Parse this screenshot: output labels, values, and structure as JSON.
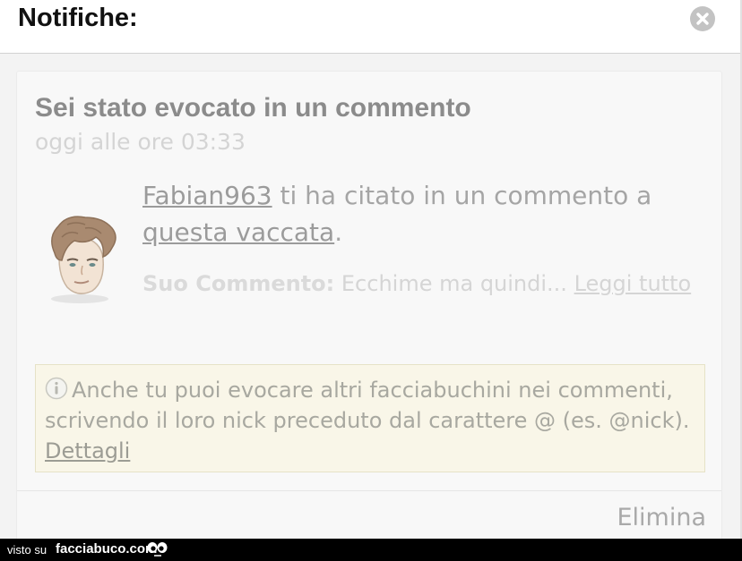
{
  "header": {
    "title": "Notifiche:",
    "close_icon": "close-circle-icon"
  },
  "notification": {
    "title": "Sei stato evocato in un commento",
    "time": "oggi alle ore 03:33",
    "avatar_icon": "cartoon-face-avatar",
    "user": "Fabian963",
    "message_middle": " ti ha citato in un commento a ",
    "post_link": "questa vaccata",
    "message_end": ".",
    "comment_label": "Suo Commento:",
    "comment_text": " Ecchime ma quindi... ",
    "read_more": "Leggi tutto"
  },
  "info": {
    "icon": "info-circle-icon",
    "text": "Anche tu puoi evocare altri facciabuchini nei commenti, scrivendo il loro nick preceduto dal carattere @ (es. @nick). ",
    "link": "Dettagli"
  },
  "actions": {
    "delete": "Elimina"
  },
  "watermark": {
    "prefix": "visto su",
    "site": "facciabuco.com",
    "logo_icon": "eyes-logo-icon"
  },
  "colors": {
    "header_bg": "#ffffff",
    "content_bg": "#f3f3f3",
    "info_bg": "#f9f6e8",
    "title_text": "#8b8b8b",
    "watermark_bg": "#000000"
  }
}
